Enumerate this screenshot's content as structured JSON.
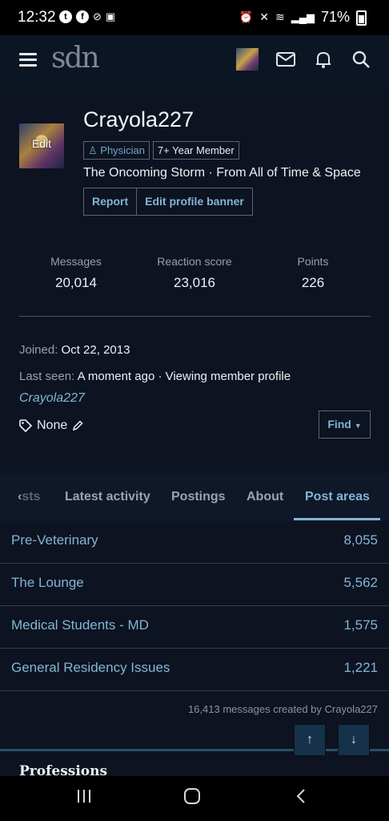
{
  "status": {
    "time": "12:32",
    "battery": "71%"
  },
  "brand": {
    "logo": "sdn"
  },
  "profile": {
    "username": "Crayola227",
    "avatar_edit": "Edit",
    "badge_physician": "Physician",
    "badge_member": "7+ Year Member",
    "tagline": "The Oncoming Storm · From All of Time & Space",
    "report": "Report",
    "edit_banner": "Edit profile banner"
  },
  "stats": [
    {
      "label": "Messages",
      "value": "20,014"
    },
    {
      "label": "Reaction score",
      "value": "23,016"
    },
    {
      "label": "Points",
      "value": "226"
    }
  ],
  "info": {
    "joined_label": "Joined:",
    "joined_value": "Oct 22, 2013",
    "seen_label": "Last seen:",
    "seen_value": "A moment ago · Viewing member profile",
    "seen_link": "Crayola227",
    "tags_value": "None",
    "find": "Find"
  },
  "tabs": [
    "sts",
    "Latest activity",
    "Postings",
    "About",
    "Post areas"
  ],
  "post_areas": [
    {
      "name": "Pre-Veterinary",
      "count": "8,055"
    },
    {
      "name": "The Lounge",
      "count": "5,562"
    },
    {
      "name": "Medical Students - MD",
      "count": "1,575"
    },
    {
      "name": "General Residency Issues",
      "count": "1,221"
    }
  ],
  "footer_note": "16,413 messages created by Crayola227",
  "section_title": "Professions",
  "icons": [
    "menu-icon",
    "mail-icon",
    "bell-icon",
    "search-icon",
    "tag-icon",
    "pencil-icon",
    "chevron-left-icon",
    "arrow-up-icon",
    "arrow-down-icon"
  ]
}
